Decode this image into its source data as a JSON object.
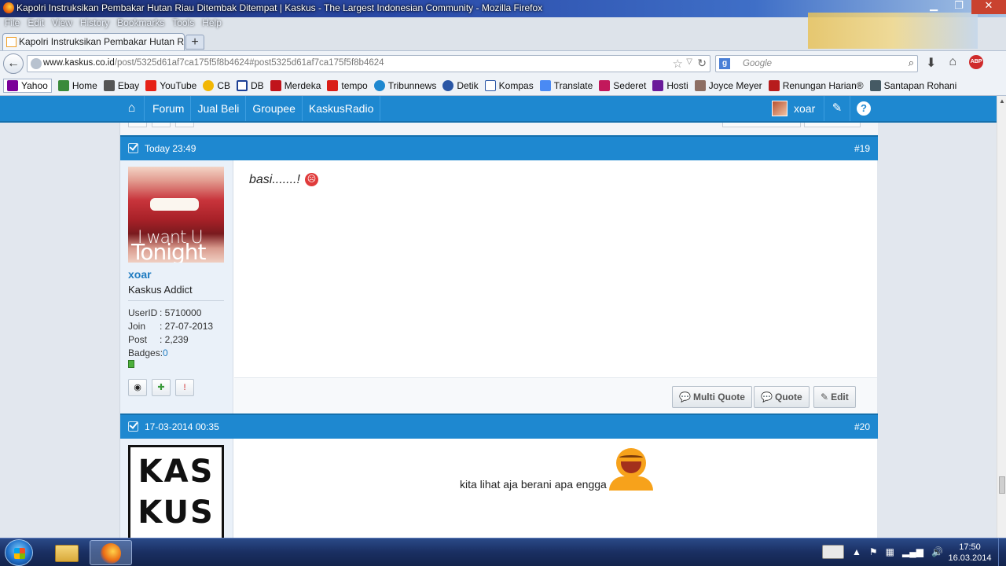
{
  "window": {
    "title": "Kapolri Instruksikan Pembakar Hutan Riau Ditembak Ditempat | Kaskus - The Largest Indonesian Community - Mozilla Firefox",
    "menu": [
      "File",
      "Edit",
      "View",
      "History",
      "Bookmarks",
      "Tools",
      "Help"
    ],
    "buttons": {
      "minimize": "▁",
      "maximize": "❐",
      "close": "✕"
    }
  },
  "tab": {
    "label": "Kapolri Instruksikan Pembakar Hutan Ria...",
    "new_tab": "+"
  },
  "nav": {
    "url_host": "www.kaskus.co.id",
    "url_path": "/post/5325d61af7ca175f5f8b4624#post5325d61af7ca175f5f8b4624",
    "search_placeholder": "Google",
    "back": "←",
    "abp": "ABP"
  },
  "bookmarks": [
    {
      "label": "Yahoo",
      "color": "#7b0099"
    },
    {
      "label": "Home",
      "color": "#3a8a3a"
    },
    {
      "label": "Ebay",
      "color": "#555555"
    },
    {
      "label": "YouTube",
      "color": "#e62117"
    },
    {
      "label": "CB",
      "color": "#f2b705"
    },
    {
      "label": "DB",
      "color": "#1c3f95"
    },
    {
      "label": "Merdeka",
      "color": "#c0141b"
    },
    {
      "label": "tempo",
      "color": "#d91e18"
    },
    {
      "label": "Tribunnews",
      "color": "#1e88d0"
    },
    {
      "label": "Detik",
      "color": "#2a56a5"
    },
    {
      "label": "Kompas",
      "color": "#ffffff"
    },
    {
      "label": "Translate",
      "color": "#4a8af4"
    },
    {
      "label": "Sederet",
      "color": "#c2185b"
    },
    {
      "label": "Hosti",
      "color": "#6a1b9a"
    },
    {
      "label": "Joyce Meyer",
      "color": "#8d6e63"
    },
    {
      "label": "Renungan Harian®",
      "color": "#b71c1c"
    },
    {
      "label": "Santapan Rohani",
      "color": "#455a64"
    }
  ],
  "sitenav": {
    "links": [
      "Forum",
      "Jual Beli",
      "Groupee",
      "KaskusRadio"
    ],
    "username": "xoar",
    "help": "?"
  },
  "posts": [
    {
      "time": "Today 23:49",
      "number": "#19",
      "user": {
        "name": "xoar",
        "rank": "Kaskus Addict",
        "avatar_text_1": "I want U",
        "avatar_text_2": "Tonight",
        "stats": [
          {
            "key": "UserID",
            "value": ": 5710000"
          },
          {
            "key": "Join",
            "value": ": 27-07-2013"
          },
          {
            "key": "Post",
            "value": ": 2,239"
          }
        ],
        "badges_label": "Badges: ",
        "badges_value": "0"
      },
      "message": "basi.......!",
      "buttons": {
        "multi_quote": "Multi Quote",
        "quote": "Quote",
        "edit": "Edit"
      }
    },
    {
      "time": "17-03-2014 00:35",
      "number": "#20",
      "user": {
        "logo_line1": "KAS",
        "logo_line2": "KUS"
      },
      "message": "kita lihat aja berani apa engga"
    }
  ],
  "taskbar": {
    "clock_time": "17:50",
    "clock_date": "16.03.2014"
  },
  "colors": {
    "kaskus_blue": "#1e88d0",
    "username_blue": "#1e7bc0"
  }
}
